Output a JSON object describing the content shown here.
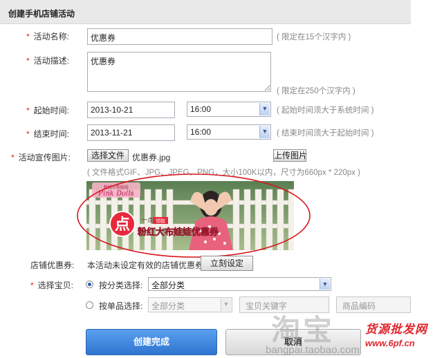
{
  "header": {
    "title": "创建手机店铺活动"
  },
  "required_mark": "*",
  "form": {
    "name": {
      "label": "活动名称:",
      "value": "优惠券",
      "hint": "( 限定在15个汉字内 )"
    },
    "desc": {
      "label": "活动描述:",
      "value": "优惠券",
      "hint": "( 限定在250个汉字内 )"
    },
    "start": {
      "label": "起始时间:",
      "date": "2013-10-21",
      "time": "16:00",
      "hint": "( 起始时间须大于系统时间 )"
    },
    "end": {
      "label": "结束时间:",
      "date": "2013-11-21",
      "time": "16:00",
      "hint": "( 结束时间须大于起始时间 )"
    },
    "image": {
      "label": "活动宣传图片:",
      "choose_btn": "选择文件",
      "file_name": "优惠券.jpg",
      "upload_btn": "上传图片",
      "hint": "( 文件格式GIF、JPG、JPEG、PNG，大小100K以内，尺寸为660px * 220px )"
    },
    "coupon": {
      "label": "店铺优惠券:",
      "text": "本活动未设定有效的店铺优惠券",
      "set_btn": "立刻设定"
    },
    "product": {
      "label": "选择宝贝:",
      "by_category": {
        "label": "按分类选择:",
        "value": "全部分类",
        "selected": true
      },
      "by_item": {
        "label": "按单品选择:",
        "category": "全部分类",
        "keyword_placeholder": "宝贝关键字",
        "code_placeholder": "商品编码",
        "selected": false
      }
    }
  },
  "banner": {
    "brand": "Pink Dolls",
    "brand_sub": "粉红小布娃娃",
    "badge": "点",
    "click_text": "一点",
    "claim": "领取",
    "slogan": "粉红大布娃娃优惠券"
  },
  "buttons": {
    "create": "创建完成",
    "cancel": "取消"
  },
  "watermark": {
    "site": "bangpai.taobao.com",
    "logo": "淘宝",
    "cn_text": "货源批发网",
    "url": "www.6pf.cn"
  },
  "colors": {
    "required": "#e02020",
    "primary_btn": "#3b86e0",
    "annotation": "#d8141c"
  }
}
